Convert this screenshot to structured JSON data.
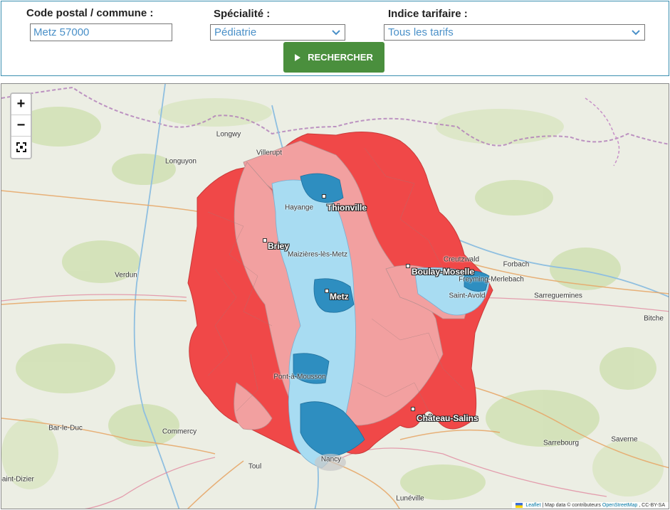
{
  "search": {
    "code_label": "Code postal / commune :",
    "code_value": "Metz 57000",
    "speciality_label": "Spécialité :",
    "speciality_value": "Pédiatrie",
    "tarif_label": "Indice tarifaire :",
    "tarif_value": "Tous les tarifs",
    "button_label": "RECHERCHER",
    "button_color": "#4a8f3d"
  },
  "map": {
    "zoom_in": "+",
    "zoom_out": "−",
    "fullscreen_icon": "fullscreen-icon",
    "colors": {
      "high": "#f04848",
      "medium": "#f2a0a0",
      "low": "#a8dcf2",
      "lowest": "#2e8ec0",
      "background": "#eceee4"
    },
    "cities": [
      {
        "name": "Thionville"
      },
      {
        "name": "Briey"
      },
      {
        "name": "Boulay-Moselle"
      },
      {
        "name": "Metz"
      },
      {
        "name": "Château-Salins"
      }
    ],
    "places": [
      "Longwy",
      "Villerupt",
      "Longuyon",
      "Verdun",
      "Bar-le-Duc",
      "Commercy",
      "Toul",
      "Nancy",
      "Lunéville",
      "Sarrebourg",
      "Saverne",
      "Bitche",
      "Sarreguemines",
      "Forbach",
      "Freyming-Merlebach",
      "Creutzwald",
      "Saint-Avold",
      "Pont-à-Mousson",
      "Hayange",
      "Maizières-lès-Metz",
      "Saint-Dizier"
    ],
    "attribution": {
      "leaflet": "Leaflet",
      "text": "| Map data © contributeurs",
      "osm": "OpenStreetMap",
      "license": ", CC-BY-SA"
    }
  }
}
